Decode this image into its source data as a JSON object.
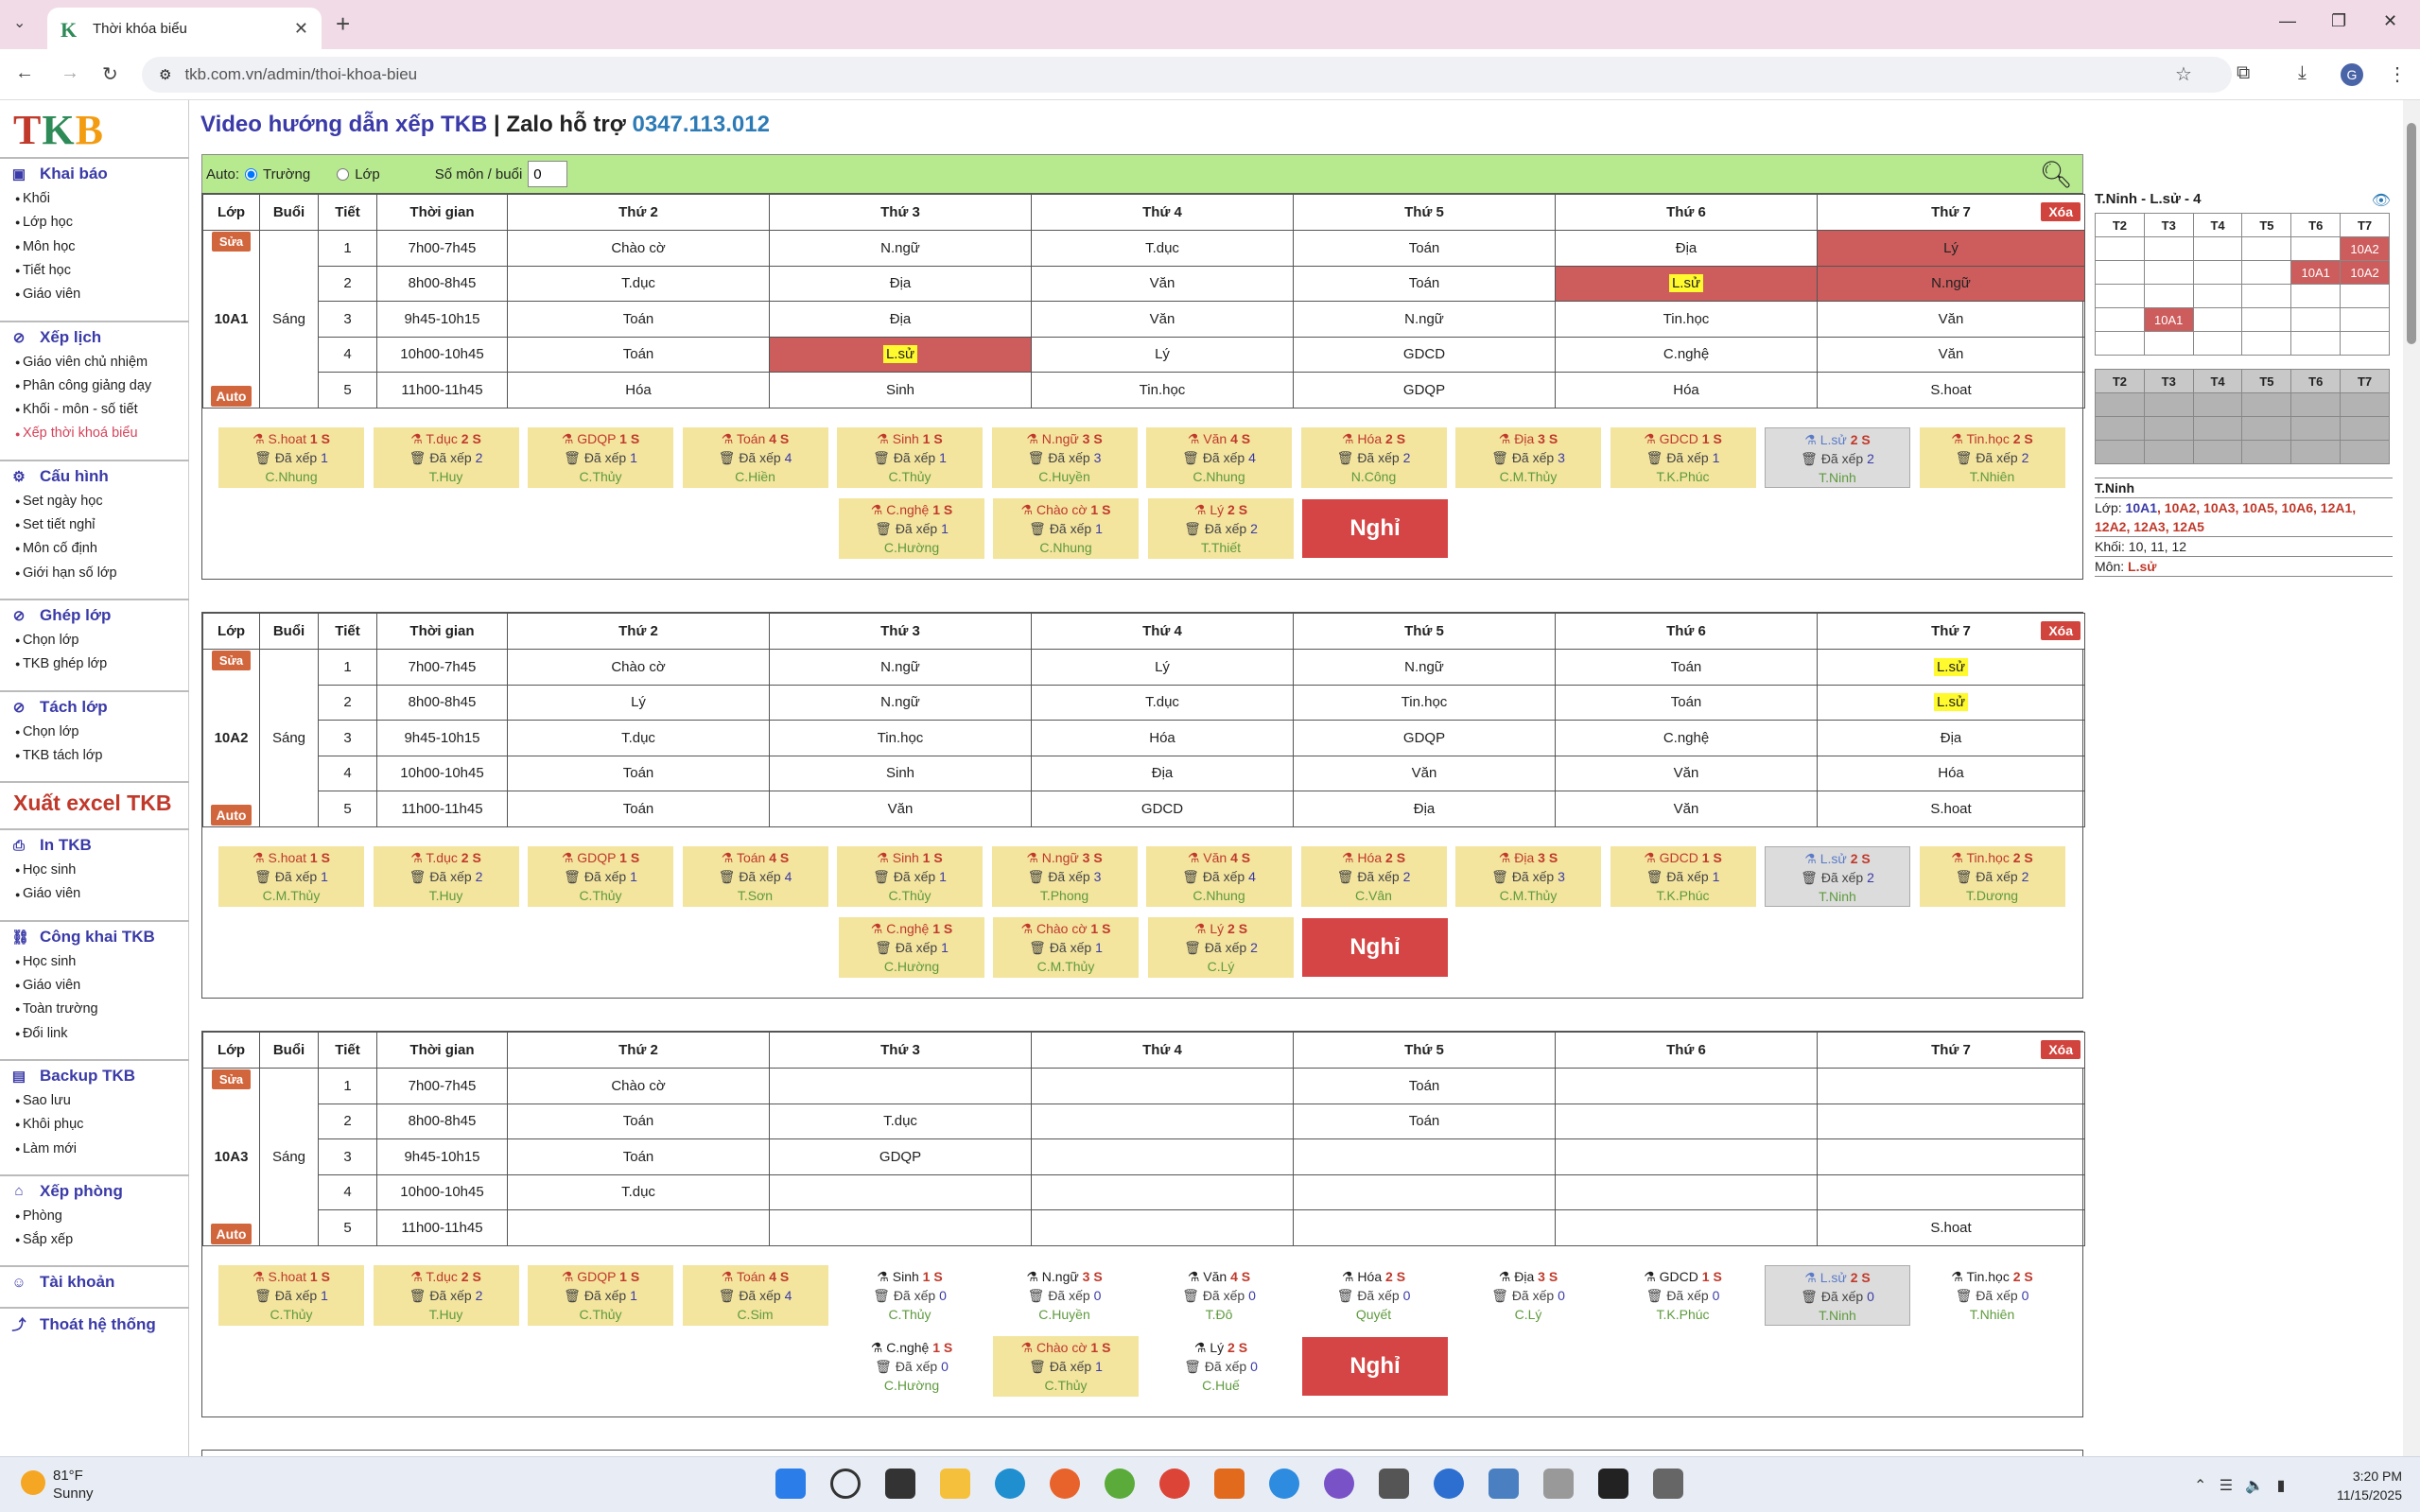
{
  "browser": {
    "tab_title": "Thời khóa biểu",
    "url": "tkb.com.vn/admin/thoi-khoa-bieu"
  },
  "sidebar": {
    "logo": "TKB",
    "sections": [
      {
        "title": "Khai báo",
        "icon": "calendar-icon",
        "items": [
          "Khối",
          "Lớp học",
          "Môn học",
          "Tiết học",
          "Giáo viên"
        ]
      },
      {
        "title": "Xếp lịch",
        "icon": "check-circle-icon",
        "items": [
          "Giáo viên chủ nhiệm",
          "Phân công giảng dạy",
          "Khối - môn - số tiết",
          "Xếp thời khoá biểu"
        ]
      },
      {
        "title": "Cấu hình",
        "icon": "gear-icon",
        "items": [
          "Set ngày học",
          "Set tiết nghỉ",
          "Môn cố định",
          "Giới hạn số lớp"
        ]
      },
      {
        "title": "Ghép lớp",
        "icon": "check-circle-icon",
        "items": [
          "Chọn lớp",
          "TKB ghép lớp"
        ]
      },
      {
        "title": "Tách lớp",
        "icon": "check-circle-icon",
        "items": [
          "Chọn lớp",
          "TKB tách lớp"
        ]
      }
    ],
    "excel": "Xuất excel TKB",
    "sections2": [
      {
        "title": "In TKB",
        "icon": "printer-icon",
        "items": [
          "Học sinh",
          "Giáo viên"
        ]
      },
      {
        "title": "Công khai TKB",
        "icon": "link-icon",
        "items": [
          "Học sinh",
          "Giáo viên",
          "Toàn trường",
          "Đổi link"
        ]
      },
      {
        "title": "Backup TKB",
        "icon": "backup-icon",
        "items": [
          "Sao lưu",
          "Khôi phục",
          "Làm mới"
        ]
      },
      {
        "title": "Xếp phòng",
        "icon": "building-icon",
        "items": [
          "Phòng",
          "Sắp xếp"
        ]
      }
    ],
    "account": "Tài khoản",
    "logout": "Thoát hệ thống"
  },
  "heading": {
    "video": "Video hướng dẫn xếp TKB",
    "sep": " | Zalo hỗ trợ ",
    "phone": "0347.113.012"
  },
  "filter": {
    "auto_label": "Auto:",
    "truong": "Trường",
    "lop": "Lớp",
    "so_mon": "Số môn / buổi",
    "so_mon_value": "0"
  },
  "table_headers": [
    "Lớp",
    "Buổi",
    "Tiết",
    "Thời gian",
    "Thứ 2",
    "Thứ 3",
    "Thứ 4",
    "Thứ 5",
    "Thứ 6",
    "Thứ 7"
  ],
  "buttons": {
    "sua": "Sửa",
    "auto": "Auto",
    "xoa": "Xóa",
    "nghi": "Nghỉ"
  },
  "times": [
    "7h00-7h45",
    "8h00-8h45",
    "9h45-10h15",
    "10h00-10h45",
    "11h00-11h45"
  ],
  "classes": [
    {
      "name": "10A1",
      "session": "Sáng",
      "rows": [
        [
          "Chào cờ",
          "N.ngữ",
          "T.dục",
          "Toán",
          "Địa",
          "Lý"
        ],
        [
          "T.dục",
          "Địa",
          "Văn",
          "Toán",
          "L.sử",
          "N.ngữ"
        ],
        [
          "Toán",
          "Địa",
          "Văn",
          "N.ngữ",
          "Tin.học",
          "Văn"
        ],
        [
          "Toán",
          "L.sử",
          "Lý",
          "GDCD",
          "C.nghệ",
          "Văn"
        ],
        [
          "Hóa",
          "Sinh",
          "Tin.học",
          "GDQP",
          "Hóa",
          "S.hoat"
        ]
      ],
      "cards": [
        {
          "subj": "S.hoat",
          "n": "1",
          "xep": "1",
          "gv": "C.Nhung",
          "st": "y"
        },
        {
          "subj": "T.dục",
          "n": "2",
          "xep": "2",
          "gv": "T.Huy",
          "st": "y"
        },
        {
          "subj": "GDQP",
          "n": "1",
          "xep": "1",
          "gv": "C.Thủy",
          "st": "y"
        },
        {
          "subj": "Toán",
          "n": "4",
          "xep": "4",
          "gv": "C.Hiền",
          "st": "y"
        },
        {
          "subj": "Sinh",
          "n": "1",
          "xep": "1",
          "gv": "C.Thủy",
          "st": "y"
        },
        {
          "subj": "N.ngữ",
          "n": "3",
          "xep": "3",
          "gv": "C.Huyền",
          "st": "y"
        },
        {
          "subj": "Văn",
          "n": "4",
          "xep": "4",
          "gv": "C.Nhung",
          "st": "y"
        },
        {
          "subj": "Hóa",
          "n": "2",
          "xep": "2",
          "gv": "N.Công",
          "st": "y"
        },
        {
          "subj": "Địa",
          "n": "3",
          "xep": "3",
          "gv": "C.M.Thủy",
          "st": "y"
        },
        {
          "subj": "GDCD",
          "n": "1",
          "xep": "1",
          "gv": "T.K.Phúc",
          "st": "y"
        },
        {
          "subj": "L.sử",
          "n": "2",
          "xep": "2",
          "gv": "T.Ninh",
          "st": "g"
        },
        {
          "subj": "Tin.học",
          "n": "2",
          "xep": "2",
          "gv": "T.Nhiên",
          "st": "y"
        },
        {
          "subj": "C.nghệ",
          "n": "1",
          "xep": "1",
          "gv": "C.Hường",
          "st": "y"
        },
        {
          "subj": "Chào cờ",
          "n": "1",
          "xep": "1",
          "gv": "C.Nhung",
          "st": "y"
        },
        {
          "subj": "Lý",
          "n": "2",
          "xep": "2",
          "gv": "T.Thiết",
          "st": "y"
        }
      ]
    },
    {
      "name": "10A2",
      "session": "Sáng",
      "rows": [
        [
          "Chào cờ",
          "N.ngữ",
          "Lý",
          "N.ngữ",
          "Toán",
          "L.sử"
        ],
        [
          "Lý",
          "N.ngữ",
          "T.dục",
          "Tin.học",
          "Toán",
          "L.sử"
        ],
        [
          "T.dục",
          "Tin.học",
          "Hóa",
          "GDQP",
          "C.nghệ",
          "Địa"
        ],
        [
          "Toán",
          "Sinh",
          "Địa",
          "Văn",
          "Văn",
          "Hóa"
        ],
        [
          "Toán",
          "Văn",
          "GDCD",
          "Địa",
          "Văn",
          "S.hoat"
        ]
      ],
      "cards": [
        {
          "subj": "S.hoat",
          "n": "1",
          "xep": "1",
          "gv": "C.M.Thủy",
          "st": "y"
        },
        {
          "subj": "T.dục",
          "n": "2",
          "xep": "2",
          "gv": "T.Huy",
          "st": "y"
        },
        {
          "subj": "GDQP",
          "n": "1",
          "xep": "1",
          "gv": "C.Thủy",
          "st": "y"
        },
        {
          "subj": "Toán",
          "n": "4",
          "xep": "4",
          "gv": "T.Sơn",
          "st": "y"
        },
        {
          "subj": "Sinh",
          "n": "1",
          "xep": "1",
          "gv": "C.Thủy",
          "st": "y"
        },
        {
          "subj": "N.ngữ",
          "n": "3",
          "xep": "3",
          "gv": "T.Phong",
          "st": "y"
        },
        {
          "subj": "Văn",
          "n": "4",
          "xep": "4",
          "gv": "C.Nhung",
          "st": "y"
        },
        {
          "subj": "Hóa",
          "n": "2",
          "xep": "2",
          "gv": "C.Vân",
          "st": "y"
        },
        {
          "subj": "Địa",
          "n": "3",
          "xep": "3",
          "gv": "C.M.Thủy",
          "st": "y"
        },
        {
          "subj": "GDCD",
          "n": "1",
          "xep": "1",
          "gv": "T.K.Phúc",
          "st": "y"
        },
        {
          "subj": "L.sử",
          "n": "2",
          "xep": "2",
          "gv": "T.Ninh",
          "st": "g"
        },
        {
          "subj": "Tin.học",
          "n": "2",
          "xep": "2",
          "gv": "T.Dương",
          "st": "y"
        },
        {
          "subj": "C.nghệ",
          "n": "1",
          "xep": "1",
          "gv": "C.Hường",
          "st": "y"
        },
        {
          "subj": "Chào cờ",
          "n": "1",
          "xep": "1",
          "gv": "C.M.Thủy",
          "st": "y"
        },
        {
          "subj": "Lý",
          "n": "2",
          "xep": "2",
          "gv": "C.Lý",
          "st": "y"
        }
      ]
    },
    {
      "name": "10A3",
      "session": "Sáng",
      "rows": [
        [
          "Chào cờ",
          "",
          "",
          "Toán",
          "",
          ""
        ],
        [
          "Toán",
          "T.dục",
          "",
          "Toán",
          "",
          ""
        ],
        [
          "Toán",
          "GDQP",
          "",
          "",
          "",
          ""
        ],
        [
          "T.dục",
          "",
          "",
          "",
          "",
          ""
        ],
        [
          "",
          "",
          "",
          "",
          "",
          "S.hoat"
        ]
      ],
      "cards": [
        {
          "subj": "S.hoat",
          "n": "1",
          "xep": "1",
          "gv": "C.Thủy",
          "st": "y"
        },
        {
          "subj": "T.dục",
          "n": "2",
          "xep": "2",
          "gv": "T.Huy",
          "st": "y"
        },
        {
          "subj": "GDQP",
          "n": "1",
          "xep": "1",
          "gv": "C.Thủy",
          "st": "y"
        },
        {
          "subj": "Toán",
          "n": "4",
          "xep": "4",
          "gv": "C.Sim",
          "st": "y"
        },
        {
          "subj": "Sinh",
          "n": "1",
          "xep": "0",
          "gv": "C.Thủy",
          "st": "w"
        },
        {
          "subj": "N.ngữ",
          "n": "3",
          "xep": "0",
          "gv": "C.Huyền",
          "st": "w"
        },
        {
          "subj": "Văn",
          "n": "4",
          "xep": "0",
          "gv": "T.Đô",
          "st": "w"
        },
        {
          "subj": "Hóa",
          "n": "2",
          "xep": "0",
          "gv": "Quyết",
          "st": "w"
        },
        {
          "subj": "Địa",
          "n": "3",
          "xep": "0",
          "gv": "C.Lý",
          "st": "w"
        },
        {
          "subj": "GDCD",
          "n": "1",
          "xep": "0",
          "gv": "T.K.Phúc",
          "st": "w"
        },
        {
          "subj": "L.sử",
          "n": "2",
          "xep": "0",
          "gv": "T.Ninh",
          "st": "g"
        },
        {
          "subj": "Tin.học",
          "n": "2",
          "xep": "0",
          "gv": "T.Nhiên",
          "st": "w"
        },
        {
          "subj": "C.nghệ",
          "n": "1",
          "xep": "0",
          "gv": "C.Hường",
          "st": "w"
        },
        {
          "subj": "Chào cờ",
          "n": "1",
          "xep": "1",
          "gv": "C.Thủy",
          "st": "y"
        },
        {
          "subj": "Lý",
          "n": "2",
          "xep": "0",
          "gv": "C.Huế",
          "st": "w"
        }
      ]
    }
  ],
  "card_labels": {
    "da_xep": "Đã xếp",
    "s": "S"
  },
  "right_panel": {
    "title": "T.Ninh - L.sử - 4",
    "days": [
      "T2",
      "T3",
      "T4",
      "T5",
      "T6",
      "T7"
    ],
    "grid": [
      [
        "",
        "",
        "",
        "",
        "",
        "10A2"
      ],
      [
        "",
        "",
        "",
        "",
        "10A1",
        "10A2"
      ],
      [
        "",
        "",
        "",
        "",
        "",
        ""
      ],
      [
        "",
        "10A1",
        "",
        "",
        "",
        ""
      ],
      [
        "",
        "",
        "",
        "",
        "",
        ""
      ]
    ],
    "teacher": "T.Ninh",
    "lop_label": "Lớp:",
    "lop_active": "10A1",
    "lop_others": ", 10A2, 10A3, 10A5, 10A6, 12A1, 12A2, 12A3, 12A5",
    "khoi": "Khối: 10, 11, 12",
    "mon_label": "Môn:",
    "mon": "L.sử"
  },
  "taskbar": {
    "temp": "81°F",
    "weather": "Sunny",
    "time": "3:20 PM",
    "date": "11/15/2025"
  }
}
